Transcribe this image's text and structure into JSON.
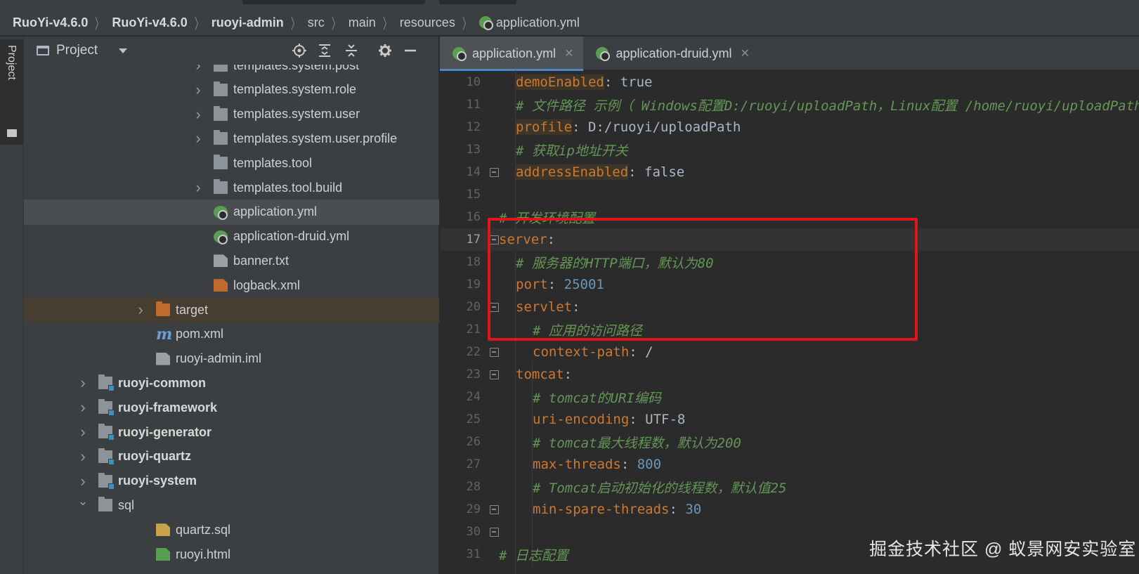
{
  "breadcrumb": [
    {
      "label": "RuoYi-v4.6.0",
      "bold": true
    },
    {
      "label": "RuoYi-v4.6.0",
      "bold": true
    },
    {
      "label": "ruoyi-admin",
      "bold": true
    },
    {
      "label": "src",
      "bold": false
    },
    {
      "label": "main",
      "bold": false
    },
    {
      "label": "resources",
      "bold": false
    },
    {
      "label": "application.yml",
      "bold": false,
      "icon": "spring-yml-icon"
    }
  ],
  "toolstrip": {
    "project_tab": "Project"
  },
  "panel": {
    "title": "Project",
    "buttons": [
      "locate-icon",
      "expand-all-icon",
      "collapse-all-icon",
      "gear-icon",
      "hide-icon"
    ]
  },
  "tree": [
    {
      "label": "templates.system.post",
      "icon": "folder-icon",
      "expandable": true,
      "depth": 2
    },
    {
      "label": "templates.system.role",
      "icon": "folder-icon",
      "expandable": true,
      "depth": 2
    },
    {
      "label": "templates.system.user",
      "icon": "folder-icon",
      "expandable": true,
      "depth": 2
    },
    {
      "label": "templates.system.user.profile",
      "icon": "folder-icon",
      "expandable": true,
      "depth": 2
    },
    {
      "label": "templates.tool",
      "icon": "folder-icon",
      "expandable": false,
      "depth": 2
    },
    {
      "label": "templates.tool.build",
      "icon": "folder-icon",
      "expandable": true,
      "depth": 2
    },
    {
      "label": "application.yml",
      "icon": "spring-yml-icon",
      "expandable": false,
      "depth": 2,
      "selected": true
    },
    {
      "label": "application-druid.yml",
      "icon": "spring-yml-icon",
      "expandable": false,
      "depth": 2
    },
    {
      "label": "banner.txt",
      "icon": "text-file-icon",
      "expandable": false,
      "depth": 2
    },
    {
      "label": "logback.xml",
      "icon": "xml-file-icon",
      "expandable": false,
      "depth": 2
    },
    {
      "label": "target",
      "icon": "excluded-folder-icon",
      "expandable": true,
      "depth": 1,
      "excluded": true
    },
    {
      "label": "pom.xml",
      "icon": "maven-icon",
      "expandable": false,
      "depth": 1
    },
    {
      "label": "ruoyi-admin.iml",
      "icon": "iml-file-icon",
      "expandable": false,
      "depth": 1
    },
    {
      "label": "ruoyi-common",
      "icon": "module-folder-icon",
      "expandable": true,
      "depth": 0,
      "bold": true
    },
    {
      "label": "ruoyi-framework",
      "icon": "module-folder-icon",
      "expandable": true,
      "depth": 0,
      "bold": true
    },
    {
      "label": "ruoyi-generator",
      "icon": "module-folder-icon",
      "expandable": true,
      "depth": 0,
      "bold": true
    },
    {
      "label": "ruoyi-quartz",
      "icon": "module-folder-icon",
      "expandable": true,
      "depth": 0,
      "bold": true
    },
    {
      "label": "ruoyi-system",
      "icon": "module-folder-icon",
      "expandable": true,
      "depth": 0,
      "bold": true
    },
    {
      "label": "sql",
      "icon": "folder-icon",
      "expandable": true,
      "expanded": true,
      "depth": 0
    },
    {
      "label": "quartz.sql",
      "icon": "sql-file-icon",
      "expandable": false,
      "depth": 1
    },
    {
      "label": "ruoyi.html",
      "icon": "html-file-icon",
      "expandable": false,
      "depth": 1
    }
  ],
  "tabs": [
    {
      "label": "application.yml",
      "active": true,
      "icon": "spring-yml-icon"
    },
    {
      "label": "application-druid.yml",
      "active": false,
      "icon": "spring-yml-icon"
    }
  ],
  "code": [
    {
      "n": "10",
      "indent": 1,
      "parts": [
        [
          "k hl",
          "demoEnabled"
        ],
        [
          "v",
          ": true"
        ]
      ]
    },
    {
      "n": "11",
      "indent": 1,
      "parts": [
        [
          "c",
          "# 文件路径 示例（ Windows配置D:/ruoyi/uploadPath，Linux配置 /home/ruoyi/uploadPath）"
        ]
      ]
    },
    {
      "n": "12",
      "indent": 1,
      "parts": [
        [
          "k hl",
          "profile"
        ],
        [
          "v",
          ": D:/ruoyi/uploadPath"
        ]
      ]
    },
    {
      "n": "13",
      "indent": 1,
      "parts": [
        [
          "c",
          "# 获取ip地址开关"
        ]
      ]
    },
    {
      "n": "14",
      "indent": 1,
      "fold": true,
      "parts": [
        [
          "k hl",
          "addressEnabled"
        ],
        [
          "v",
          ": false"
        ]
      ]
    },
    {
      "n": "15",
      "indent": 0,
      "parts": []
    },
    {
      "n": "16",
      "indent": 0,
      "parts": [
        [
          "c",
          "# 开发环境配置"
        ]
      ]
    },
    {
      "n": "17",
      "indent": 0,
      "fold": true,
      "current": true,
      "parts": [
        [
          "k",
          "server"
        ],
        [
          "v",
          ":"
        ]
      ]
    },
    {
      "n": "18",
      "indent": 1,
      "parts": [
        [
          "c",
          "# 服务器的HTTP端口，默认为80"
        ]
      ]
    },
    {
      "n": "19",
      "indent": 1,
      "parts": [
        [
          "k",
          "port"
        ],
        [
          "v",
          ": "
        ],
        [
          "n",
          "25001"
        ]
      ]
    },
    {
      "n": "20",
      "indent": 1,
      "fold": true,
      "parts": [
        [
          "k",
          "servlet"
        ],
        [
          "v",
          ":"
        ]
      ]
    },
    {
      "n": "21",
      "indent": 2,
      "parts": [
        [
          "c",
          "# 应用的访问路径"
        ]
      ]
    },
    {
      "n": "22",
      "indent": 2,
      "fold": true,
      "parts": [
        [
          "k",
          "context-path"
        ],
        [
          "v",
          ": /"
        ]
      ]
    },
    {
      "n": "23",
      "indent": 1,
      "fold": true,
      "parts": [
        [
          "k",
          "tomcat"
        ],
        [
          "v",
          ":"
        ]
      ]
    },
    {
      "n": "24",
      "indent": 2,
      "parts": [
        [
          "c",
          "# tomcat的URI编码"
        ]
      ]
    },
    {
      "n": "25",
      "indent": 2,
      "parts": [
        [
          "k",
          "uri-encoding"
        ],
        [
          "v",
          ": UTF-8"
        ]
      ]
    },
    {
      "n": "26",
      "indent": 2,
      "parts": [
        [
          "c",
          "# tomcat最大线程数，默认为200"
        ]
      ]
    },
    {
      "n": "27",
      "indent": 2,
      "parts": [
        [
          "k",
          "max-threads"
        ],
        [
          "v",
          ": "
        ],
        [
          "n",
          "800"
        ]
      ]
    },
    {
      "n": "28",
      "indent": 2,
      "parts": [
        [
          "c",
          "# Tomcat启动初始化的线程数，默认值25"
        ]
      ]
    },
    {
      "n": "29",
      "indent": 2,
      "fold": true,
      "parts": [
        [
          "k",
          "min-spare-threads"
        ],
        [
          "v",
          ": "
        ],
        [
          "n",
          "30"
        ]
      ]
    },
    {
      "n": "30",
      "indent": 0,
      "fold": true,
      "parts": []
    },
    {
      "n": "31",
      "indent": 0,
      "parts": [
        [
          "c",
          "# 日志配置"
        ]
      ]
    }
  ],
  "watermark": "掘金技术社区 @ 蚁景网安实验室",
  "colors": {
    "highlight_box": "#e0161a",
    "keyword": "#cc7832",
    "comment": "#629755",
    "number": "#6897bb"
  }
}
